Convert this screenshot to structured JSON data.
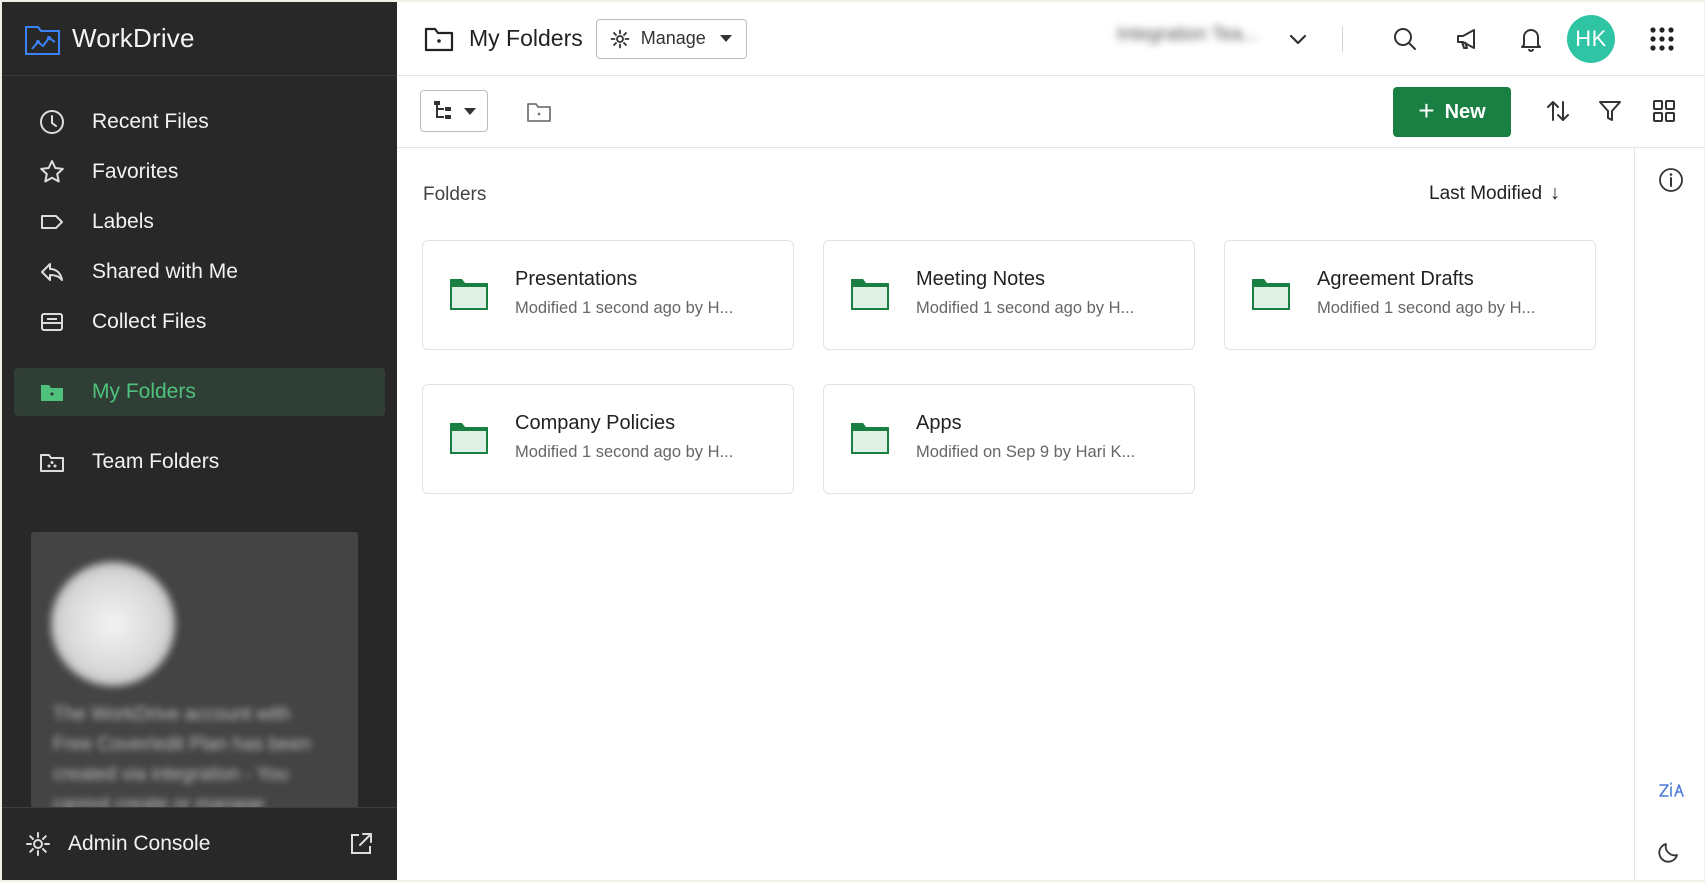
{
  "brand": {
    "name": "WorkDrive"
  },
  "sidebar": {
    "items": [
      {
        "label": "Recent Files",
        "icon": "clock-icon"
      },
      {
        "label": "Favorites",
        "icon": "star-icon"
      },
      {
        "label": "Labels",
        "icon": "label-icon"
      },
      {
        "label": "Shared with Me",
        "icon": "reply-icon"
      },
      {
        "label": "Collect Files",
        "icon": "inbox-icon"
      },
      {
        "label": "My Folders",
        "icon": "folder-icon",
        "active": true
      },
      {
        "label": "Team Folders",
        "icon": "team-folder-icon"
      }
    ],
    "promo": {
      "text": "The WorkDrive account with Free Cover/edit Plan has been created via integration - You cannot create or manage"
    },
    "admin": {
      "label": "Admin Console"
    }
  },
  "header": {
    "title": "My Folders",
    "manage_label": "Manage",
    "org_name": "Integration Tea...",
    "avatar_initials": "HK"
  },
  "toolbar": {
    "new_label": "New"
  },
  "main": {
    "section_label": "Folders",
    "sort_label": "Last Modified",
    "sort_arrow": "↓",
    "folders": [
      {
        "name": "Presentations",
        "meta": "Modified 1 second ago by H..."
      },
      {
        "name": "Meeting Notes",
        "meta": "Modified 1 second ago by H..."
      },
      {
        "name": "Agreement Drafts",
        "meta": "Modified 1 second ago by H..."
      },
      {
        "name": "Company Policies",
        "meta": "Modified 1 second ago by H..."
      },
      {
        "name": "Apps",
        "meta": "Modified on Sep 9 by Hari K..."
      }
    ]
  },
  "colors": {
    "sidebar_bg": "#282828",
    "accent_green": "#1a7f43",
    "active_text": "#4ec27c",
    "avatar_bg": "#2ec4a4"
  }
}
